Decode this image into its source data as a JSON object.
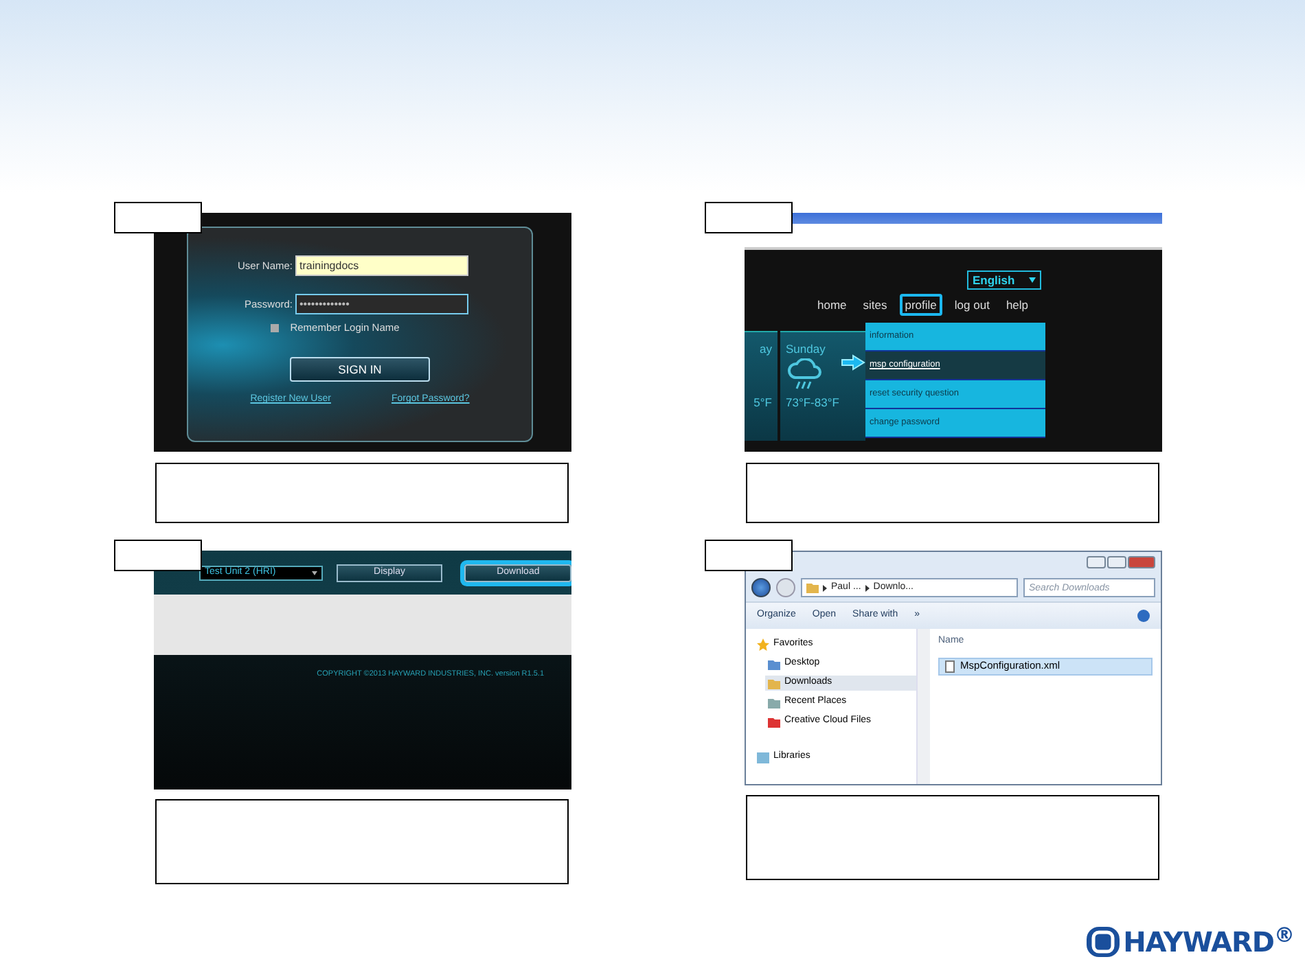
{
  "login_screen": {
    "username_label": "User Name:",
    "username_value": "trainingdocs",
    "password_label": "Password:",
    "password_value": "•••••••••••••",
    "remember": {
      "label": "Remember Login Name",
      "checked": false
    },
    "sign_in_button": "SIGN IN",
    "links": [
      "Register New User",
      "Forgot Password?"
    ]
  },
  "profile_menu_screen": {
    "language": "English",
    "nav": [
      {
        "label": "home",
        "selected": false
      },
      {
        "label": "sites",
        "selected": false
      },
      {
        "label": "profile",
        "selected": true
      },
      {
        "label": "log out",
        "selected": false
      },
      {
        "label": "help",
        "selected": false
      }
    ],
    "menu_items": [
      {
        "label": "information",
        "selected": false
      },
      {
        "label": "msp configuration",
        "selected": true
      },
      {
        "label": "reset security question",
        "selected": false
      },
      {
        "label": "change password",
        "selected": false
      }
    ],
    "weather": [
      {
        "day": "ay",
        "temp": "5°F"
      },
      {
        "day": "Sunday",
        "temp": "73°F-83°F"
      }
    ]
  },
  "download_screen": {
    "unit_select": "Test Unit 2 (HRI)",
    "buttons": [
      {
        "label": "Display",
        "selected": false
      },
      {
        "label": "Download",
        "selected": true
      }
    ],
    "copyright": "COPYRIGHT ©2013 HAYWARD INDUSTRIES, INC. version R1.5.1"
  },
  "explorer_window": {
    "breadcrumb": [
      "Paul ...",
      "Downlo..."
    ],
    "search": {
      "placeholder": "Search Downloads"
    },
    "toolbar": [
      "Organize",
      "Open",
      "Share with",
      "»"
    ],
    "sidebar": [
      {
        "label": "Favorites",
        "kind": "header",
        "selected": false
      },
      {
        "label": "Desktop",
        "kind": "item",
        "selected": false
      },
      {
        "label": "Downloads",
        "kind": "item",
        "selected": true
      },
      {
        "label": "Recent Places",
        "kind": "item",
        "selected": false
      },
      {
        "label": "Creative Cloud Files",
        "kind": "item",
        "selected": false
      },
      {
        "label": "Libraries",
        "kind": "header",
        "selected": false
      }
    ],
    "column": "Name",
    "files": [
      {
        "name": "MspConfiguration.xml",
        "selected": true
      }
    ]
  },
  "logo": "HAYWARD$^{®}$"
}
